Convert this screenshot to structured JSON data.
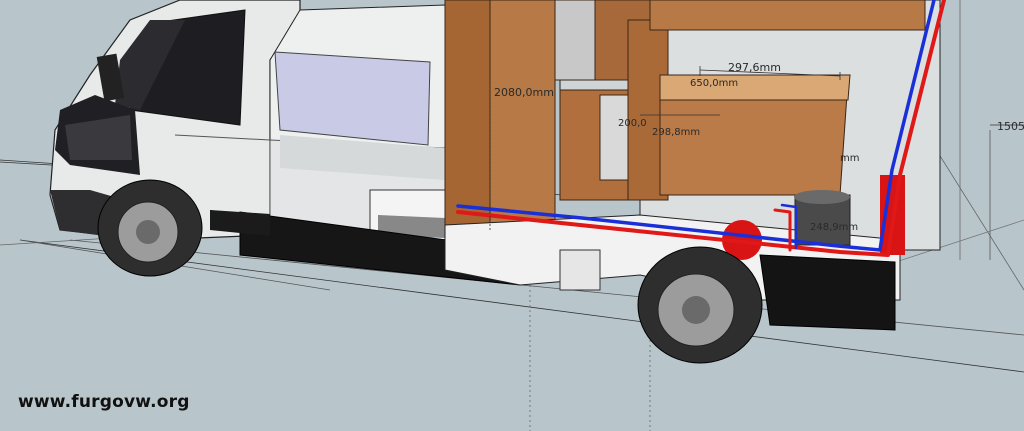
{
  "watermark": "www.furgovw.org",
  "dimensions": {
    "d1": "2080,0mm",
    "d2": "297,6mm",
    "d3": "650,0mm",
    "d4": "200,0",
    "d5": "298,8mm",
    "d6": "mm",
    "d7": "248,9mm",
    "d8": "1505"
  },
  "colors": {
    "sky": "#b8c6cc",
    "van_body": "#e6e8e8",
    "wood": "#b06f3c",
    "hot_pipe": "#e01818",
    "cold_pipe": "#1a2fd8",
    "tire": "#3a3a3a"
  }
}
